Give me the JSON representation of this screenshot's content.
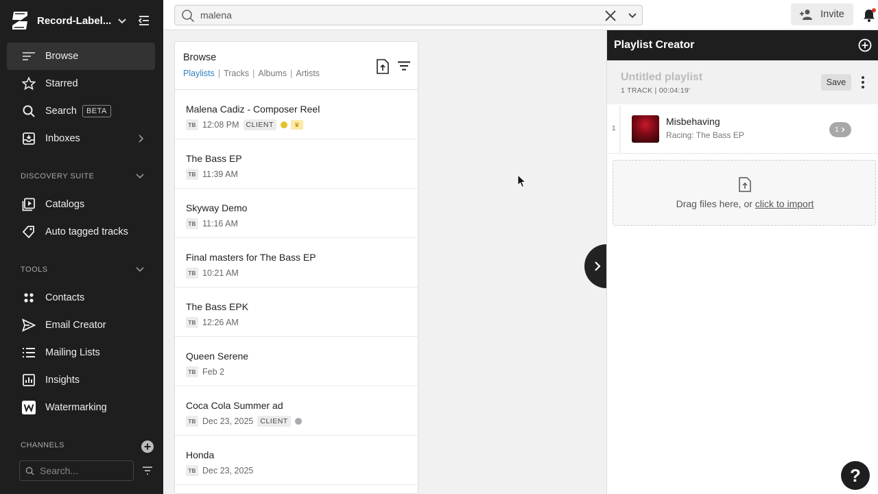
{
  "workspace": {
    "name": "Record-Label..."
  },
  "sidebar": {
    "items": [
      {
        "label": "Browse",
        "icon": "browse-lines-icon",
        "active": true
      },
      {
        "label": "Starred",
        "icon": "star-icon"
      },
      {
        "label": "Search",
        "icon": "search-icon",
        "badge": "BETA"
      },
      {
        "label": "Inboxes",
        "icon": "inbox-icon"
      }
    ],
    "discovery_header": "DISCOVERY SUITE",
    "discovery_items": [
      {
        "label": "Catalogs",
        "icon": "catalog-icon"
      },
      {
        "label": "Auto tagged tracks",
        "icon": "auto-tag-icon"
      }
    ],
    "tools_header": "TOOLS",
    "tools_items": [
      {
        "label": "Contacts",
        "icon": "contacts-icon"
      },
      {
        "label": "Email Creator",
        "icon": "send-icon"
      },
      {
        "label": "Mailing Lists",
        "icon": "list-icon"
      },
      {
        "label": "Insights",
        "icon": "chart-icon"
      },
      {
        "label": "Watermarking",
        "icon": "watermark-icon"
      }
    ],
    "channels_header": "CHANNELS",
    "channels_search_placeholder": "Search..."
  },
  "topbar": {
    "search_value": "malena",
    "invite_label": "Invite"
  },
  "browse": {
    "title": "Browse",
    "tabs": [
      "Playlists",
      "Tracks",
      "Albums",
      "Artists"
    ],
    "active_tab": "Playlists",
    "rows": [
      {
        "name": "Malena Cadiz - Composer Reel",
        "owner": "TB",
        "time": "12:08 PM",
        "tag": "CLIENT",
        "dot_color": "#e6c02a",
        "crown": true
      },
      {
        "name": "The Bass EP",
        "owner": "TB",
        "time": "11:39 AM"
      },
      {
        "name": "Skyway Demo",
        "owner": "TB",
        "time": "11:16 AM"
      },
      {
        "name": "Final masters for The Bass EP",
        "owner": "TB",
        "time": "10:21 AM"
      },
      {
        "name": "The Bass EPK",
        "owner": "TB",
        "time": "12:26 AM"
      },
      {
        "name": "Queen Serene",
        "owner": "TB",
        "time": "Feb 2"
      },
      {
        "name": "Coca Cola Summer ad",
        "owner": "TB",
        "time": "Dec 23, 2025",
        "tag": "CLIENT",
        "dot_color": "#a9a9b0"
      },
      {
        "name": "Honda",
        "owner": "TB",
        "time": "Dec 23, 2025"
      }
    ]
  },
  "playlist": {
    "header": "Playlist Creator",
    "name": "Untitled playlist",
    "info": "1 TRACK | 00:04:19'",
    "save_label": "Save",
    "track": {
      "num": "1",
      "title": "Misbehaving",
      "subtitle": "Racing: The Bass EP",
      "count": "1"
    },
    "drop_text": "Drag files here, or ",
    "drop_link": "click to import"
  },
  "help_label": "?"
}
